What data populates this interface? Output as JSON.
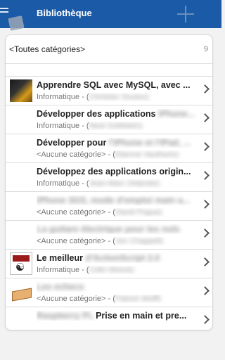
{
  "app": {
    "title": "Bibliothèque"
  },
  "category_filter": {
    "label": "<Toutes catégories>",
    "count": "9"
  },
  "books": [
    {
      "title": "Apprendre SQL avec MySQL, avec ...",
      "title_blur": "",
      "category": "Informatique - (",
      "author_blur": "Christian Soutou)",
      "thumb": "t1"
    },
    {
      "title": "Développer des applications ",
      "title_blur": "iPhone...",
      "category": "Informatique - (",
      "author_blur": "Neal Goldstein)",
      "thumb": ""
    },
    {
      "title": "Développer pour ",
      "title_blur": "l'iPhone et l'iPad, ...",
      "category": "<Aucune catégorie> - (",
      "author_blur": "Etienne Vautherin)",
      "thumb": ""
    },
    {
      "title": "Développez des applications origin...",
      "title_blur": "",
      "category": "Informatique - (",
      "author_blur": "Jean-Marc Delprato)",
      "thumb": ""
    },
    {
      "title": "",
      "title_blur": "iPhone 3GS, mode d'emploi main a...",
      "category": "<Aucune catégorie> - (",
      "author_blur": "David Pogue)",
      "thumb": ""
    },
    {
      "title": "",
      "title_blur": "La guitare électrique pour les nuls",
      "category": "<Aucune catégorie> - (",
      "author_blur": "Jon Chappell)",
      "thumb": ""
    },
    {
      "title": "Le meilleur ",
      "title_blur": "d'ActionScript 2.0",
      "category": "Informatique - (",
      "author_blur": "Colin Moock)",
      "thumb": "t7"
    },
    {
      "title": "",
      "title_blur": "Les echecs",
      "category": "<Aucune catégorie> - (",
      "author_blur": "Patrick Wolff)",
      "thumb": "t8"
    },
    {
      "title": "Prise en main et pre...",
      "title_blur": "Raspberry Pi,",
      "category": "",
      "author_blur": "",
      "thumb": ""
    }
  ]
}
